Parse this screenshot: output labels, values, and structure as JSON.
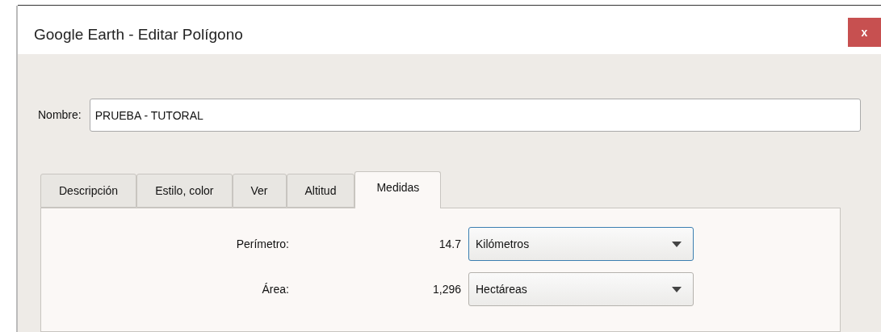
{
  "window": {
    "title": "Google Earth - Editar Polígono",
    "close": "x"
  },
  "name_field": {
    "label": "Nombre:",
    "value": "PRUEBA - TUTORAL"
  },
  "tabs": [
    {
      "label": "Descripción",
      "selected": false
    },
    {
      "label": "Estilo, color",
      "selected": false
    },
    {
      "label": "Ver",
      "selected": false
    },
    {
      "label": "Altitud",
      "selected": false
    },
    {
      "label": "Medidas",
      "selected": true
    }
  ],
  "measures": [
    {
      "label": "Perímetro:",
      "value": "14.7",
      "unit": "Kilómetros",
      "focused": true
    },
    {
      "label": "Área:",
      "value": "1,296",
      "unit": "Hectáreas",
      "focused": false
    }
  ]
}
